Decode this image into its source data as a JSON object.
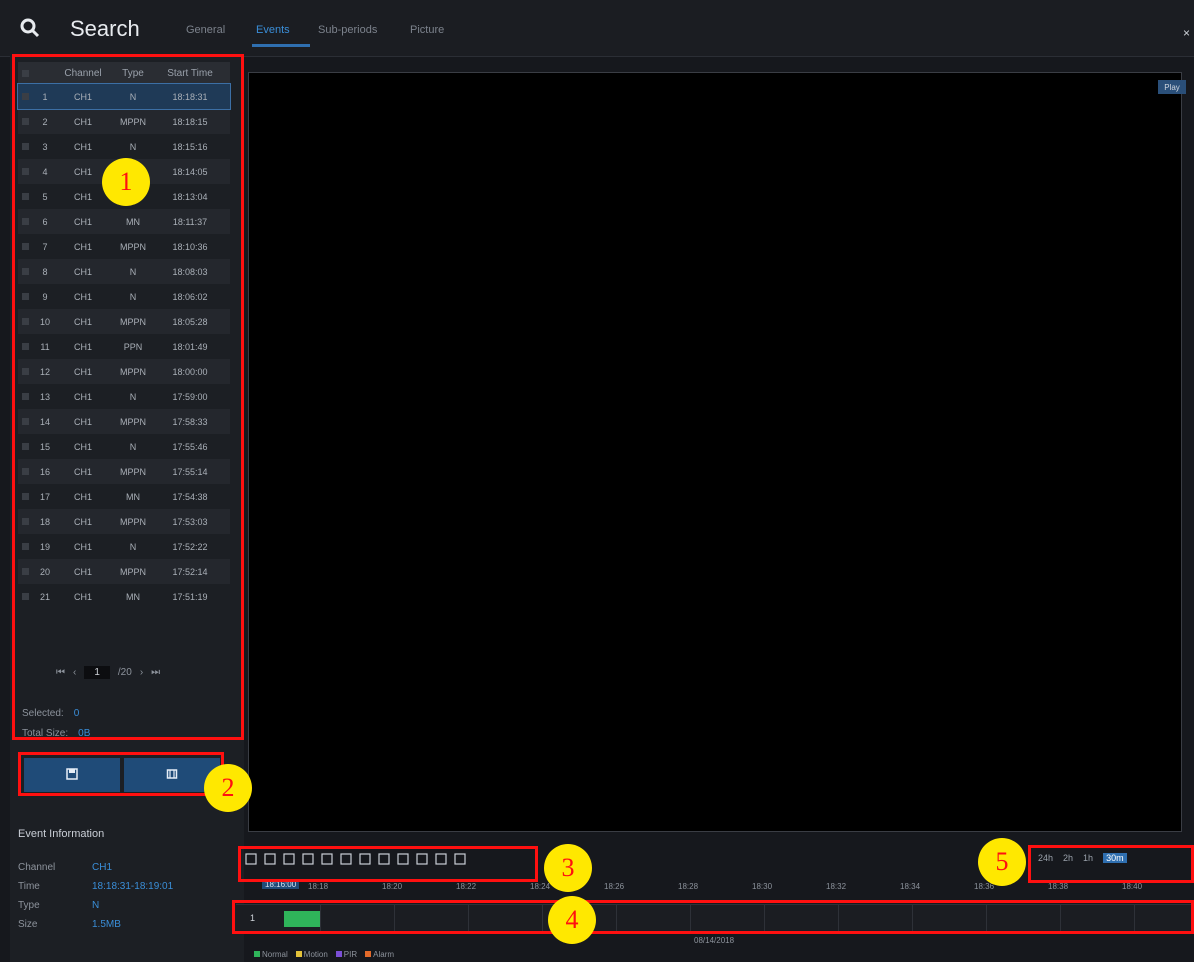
{
  "header": {
    "title": "Search",
    "tabs": [
      {
        "label": "General"
      },
      {
        "label": "Events",
        "active": true
      },
      {
        "label": "Sub-periods"
      },
      {
        "label": "Picture"
      }
    ],
    "close_glyph": "×"
  },
  "event_list": {
    "columns": [
      "",
      "Channel",
      "Type",
      "Start Time"
    ],
    "rows": [
      {
        "num": "1",
        "channel": "CH1",
        "type": "N",
        "time": "18:18:31"
      },
      {
        "num": "2",
        "channel": "CH1",
        "type": "MPPN",
        "time": "18:18:15"
      },
      {
        "num": "3",
        "channel": "CH1",
        "type": "N",
        "time": "18:15:16"
      },
      {
        "num": "4",
        "channel": "CH1",
        "type": "",
        "time": "18:14:05"
      },
      {
        "num": "5",
        "channel": "CH1",
        "type": "NM",
        "time": "18:13:04"
      },
      {
        "num": "6",
        "channel": "CH1",
        "type": "MN",
        "time": "18:11:37"
      },
      {
        "num": "7",
        "channel": "CH1",
        "type": "MPPN",
        "time": "18:10:36"
      },
      {
        "num": "8",
        "channel": "CH1",
        "type": "N",
        "time": "18:08:03"
      },
      {
        "num": "9",
        "channel": "CH1",
        "type": "N",
        "time": "18:06:02"
      },
      {
        "num": "10",
        "channel": "CH1",
        "type": "MPPN",
        "time": "18:05:28"
      },
      {
        "num": "11",
        "channel": "CH1",
        "type": "PPN",
        "time": "18:01:49"
      },
      {
        "num": "12",
        "channel": "CH1",
        "type": "MPPN",
        "time": "18:00:00"
      },
      {
        "num": "13",
        "channel": "CH1",
        "type": "N",
        "time": "17:59:00"
      },
      {
        "num": "14",
        "channel": "CH1",
        "type": "MPPN",
        "time": "17:58:33"
      },
      {
        "num": "15",
        "channel": "CH1",
        "type": "N",
        "time": "17:55:46"
      },
      {
        "num": "16",
        "channel": "CH1",
        "type": "MPPN",
        "time": "17:55:14"
      },
      {
        "num": "17",
        "channel": "CH1",
        "type": "MN",
        "time": "17:54:38"
      },
      {
        "num": "18",
        "channel": "CH1",
        "type": "MPPN",
        "time": "17:53:03"
      },
      {
        "num": "19",
        "channel": "CH1",
        "type": "N",
        "time": "17:52:22"
      },
      {
        "num": "20",
        "channel": "CH1",
        "type": "MPPN",
        "time": "17:52:14"
      },
      {
        "num": "21",
        "channel": "CH1",
        "type": "MN",
        "time": "17:51:19"
      }
    ],
    "pager": {
      "first": "⏮",
      "prev": "‹",
      "page": "1",
      "total": "/20",
      "next": "›",
      "last": "⏭"
    },
    "selected_label": "Selected:",
    "selected_value": "0",
    "total_size_label": "Total Size:",
    "total_size_value": "0B"
  },
  "actions": {
    "backup_icon": "backup-icon",
    "lock_icon": "lock-icon"
  },
  "event_information": {
    "title": "Event Information",
    "fields": [
      {
        "label": "Channel",
        "value": "CH1"
      },
      {
        "label": "Time",
        "value": "18:18:31-18:19:01"
      },
      {
        "label": "Type",
        "value": "N"
      },
      {
        "label": "Size",
        "value": "1.5MB"
      }
    ]
  },
  "player": {
    "play_label": "Play"
  },
  "toolbar": {
    "icons": [
      "play-icon",
      "cut-icon",
      "rewind-icon",
      "forward-icon",
      "slow-icon",
      "frame-icon",
      "stop-icon",
      "pause-icon",
      "snapshot-icon",
      "save-icon",
      "audio-icon",
      "fullscreen-icon"
    ]
  },
  "zoom": {
    "options": [
      "24h",
      "2h",
      "1h",
      "30m"
    ],
    "active": "30m"
  },
  "timeline": {
    "current": "18:16:00",
    "ticks": [
      "18:18",
      "18:20",
      "18:22",
      "18:24",
      "18:26",
      "18:28",
      "18:30",
      "18:32",
      "18:34",
      "18:36",
      "18:38",
      "18:40",
      "18:42"
    ],
    "channel": "1",
    "date": "08/14/2018"
  },
  "legend": [
    {
      "label": "Normal",
      "color": "#2fb45a"
    },
    {
      "label": "Motion",
      "color": "#e3c23a"
    },
    {
      "label": "PIR",
      "color": "#7b4fd6"
    },
    {
      "label": "Alarm",
      "color": "#e36a2a"
    }
  ],
  "callouts": [
    "1",
    "2",
    "3",
    "4",
    "5"
  ],
  "colors": {
    "accent": "#2f6fb0",
    "callout_border": "#ff1010",
    "callout_badge": "#ffe800"
  }
}
